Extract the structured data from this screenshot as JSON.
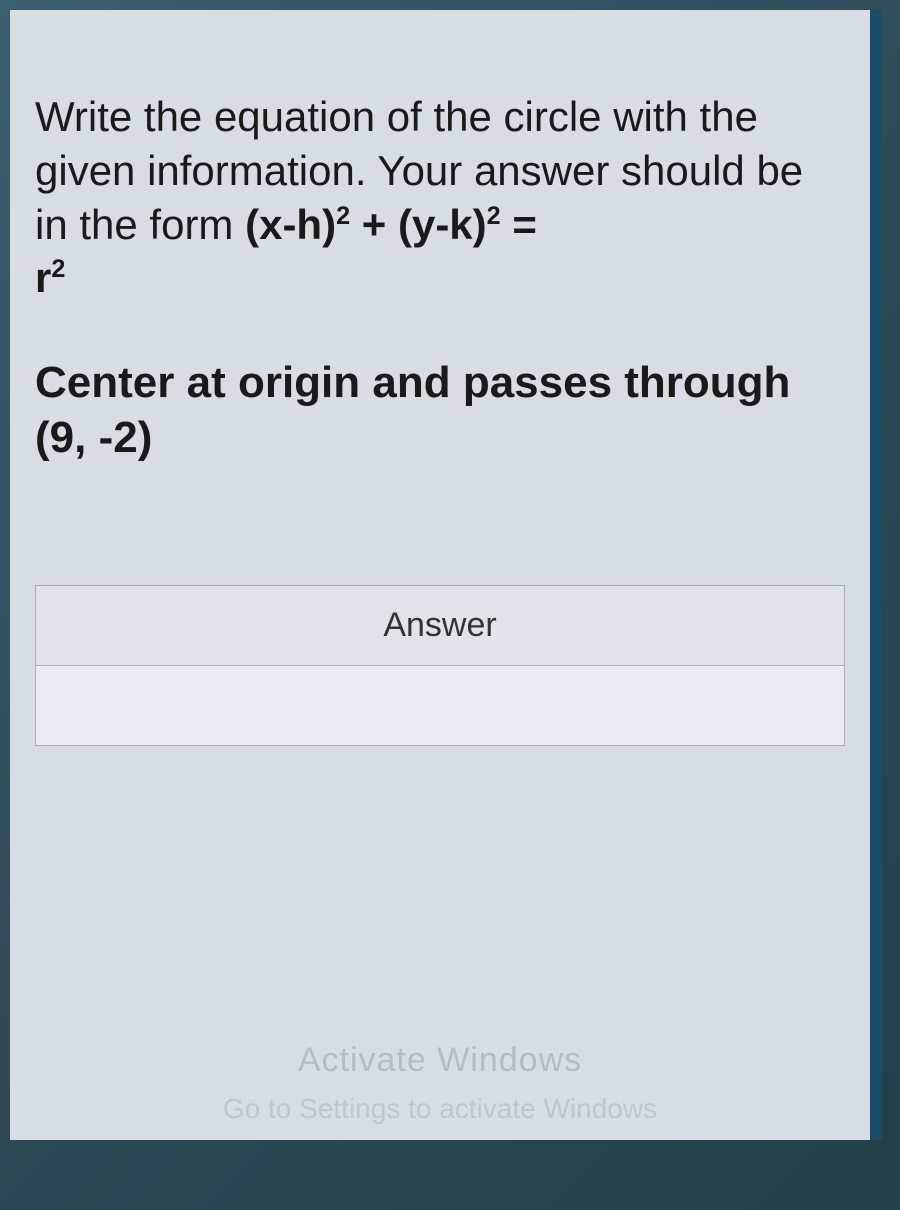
{
  "question": {
    "instruction_part1": "Write the equation of the circle with the given information. Your answer should be in the form ",
    "formula_prefix": "(x-h)",
    "formula_plus": " + ",
    "formula_mid": "(y-k)",
    "formula_equals": " = ",
    "formula_r": "r",
    "detail": "Center at origin and passes through (9, -2)"
  },
  "answer_box": {
    "header": "Answer",
    "value": ""
  },
  "watermark": {
    "line1": "Activate Windows",
    "line2": "Go to Settings to activate Windows"
  }
}
